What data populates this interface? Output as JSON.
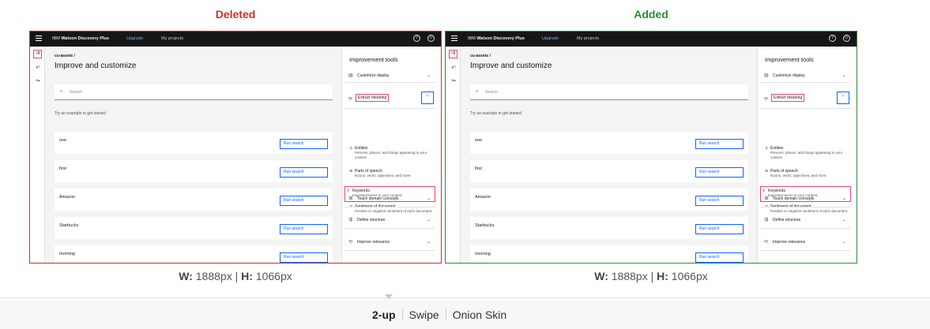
{
  "labels": {
    "deleted": "Deleted",
    "added": "Added"
  },
  "dims": {
    "w_label": "W:",
    "w_value": "1888px",
    "sep": "|",
    "h_label": "H:",
    "h_value": "1066px"
  },
  "modes": [
    "2-up",
    "Swipe",
    "Onion Skin"
  ],
  "colors": {
    "deleted": "#c9302c",
    "added": "#2e8b3a",
    "highlight": "#e0457b",
    "accent": "#0f62fe"
  },
  "app": {
    "brand_prefix": "IBM ",
    "brand_name": "Watson Discovery Plus",
    "upgrade": "Upgrade",
    "projects": "My projects",
    "breadcrumb": "cu-assets  /",
    "title": "Improve and customize",
    "search_placeholder": "Search",
    "try_text": "Try an example to get started",
    "run_label": "Run search",
    "examples": [
      "one",
      "first",
      "Amazon",
      "Starbucks",
      "morning"
    ],
    "tools_heading": "Improvement tools",
    "tools_top": [
      {
        "icon": "display-icon",
        "label": "Customize display"
      },
      {
        "icon": "extract-icon",
        "label": "Extract meaning"
      }
    ],
    "subtools": [
      {
        "icon": "entities-icon",
        "title": "Entities",
        "desc": "Persons, places, and things appearing in your content."
      },
      {
        "icon": "speech-icon",
        "title": "Parts of speech",
        "desc": "Nouns, verbs, adjectives, and more."
      },
      {
        "icon": "keywords-icon",
        "title": "Keywords",
        "desc": "Important terms in your content."
      },
      {
        "icon": "sentiment-icon",
        "title": "Sentiment of document",
        "desc": "Positive or negative sentiment of each document."
      }
    ],
    "tools_bottom": [
      {
        "icon": "concepts-icon",
        "label": "Teach domain concepts"
      },
      {
        "icon": "structure-icon",
        "label": "Define structure"
      },
      {
        "icon": "relevance-icon",
        "label": "Improve relevance"
      }
    ]
  }
}
